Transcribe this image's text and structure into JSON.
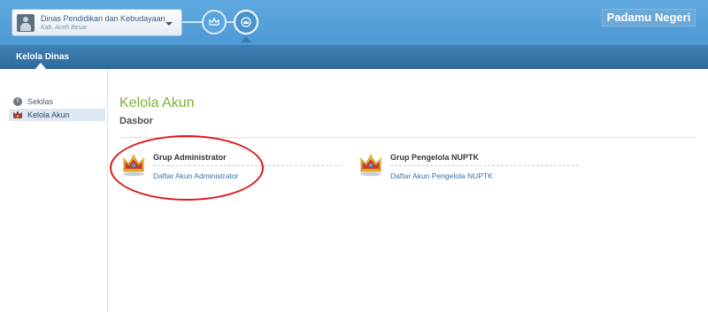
{
  "header": {
    "org_name": "Dinas Pendidikan dan Kebudayaan",
    "org_location": "Kab. Aceh Besar",
    "brand": "Padamu Negeri"
  },
  "nav": {
    "section": "Kelola Dinas"
  },
  "sidebar": {
    "items": [
      {
        "label": "Sekilas",
        "icon": "info-icon",
        "active": false
      },
      {
        "label": "Kelola Akun",
        "icon": "crown-icon",
        "active": true
      }
    ]
  },
  "main": {
    "title": "Kelola Akun",
    "subtitle": "Dasbor",
    "groups": [
      {
        "title": "Grup Administrator",
        "link": "Daftar Akun Administrator",
        "icon": "crown-icon"
      },
      {
        "title": "Grup Pengelola NUPTK",
        "link": "Daftar Akun Pengelola NUPTK",
        "icon": "crown-icon"
      }
    ]
  },
  "colors": {
    "topbar": "#55a1dc",
    "subbar": "#3774a7",
    "title_green": "#7ab03a",
    "link": "#3a6fa5",
    "annotation": "#e0141b"
  }
}
